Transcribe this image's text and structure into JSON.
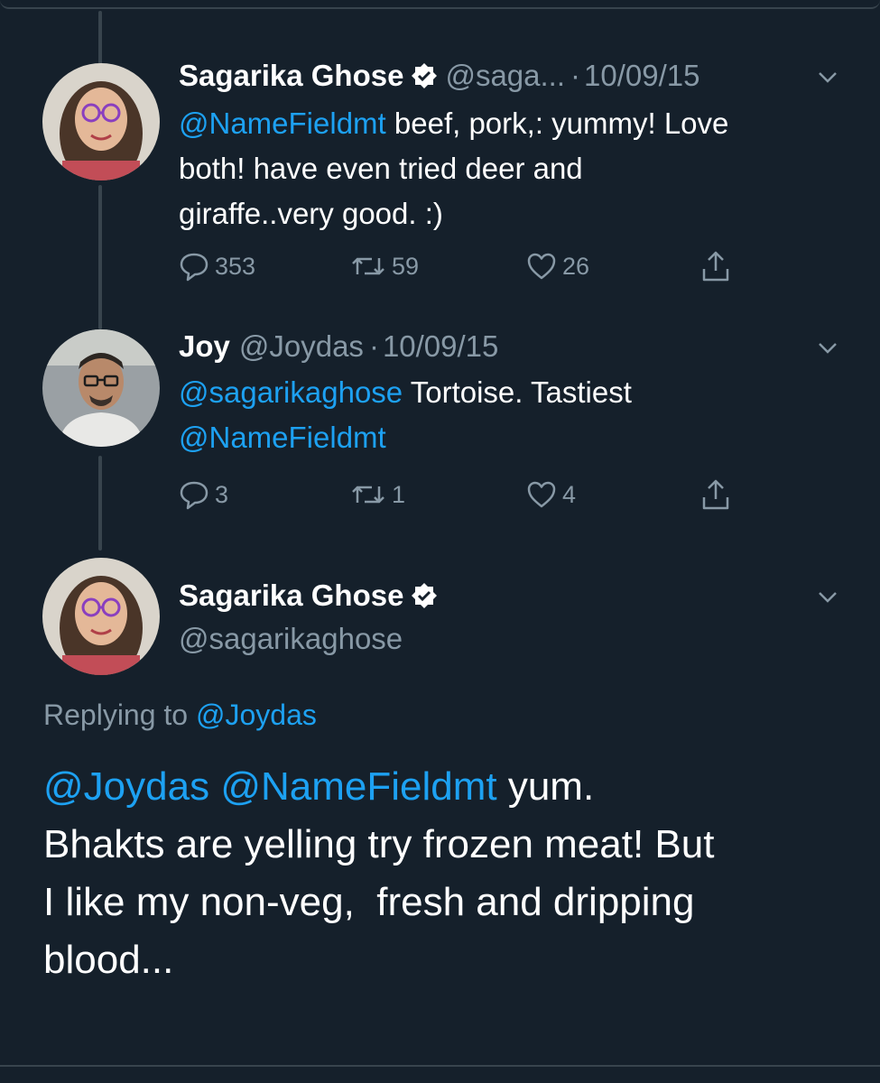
{
  "colors": {
    "background": "#15202b",
    "accent": "#1da1f2",
    "secondary_text": "#8899a6",
    "divider": "#38444d"
  },
  "tweets": [
    {
      "name": "Sagarika Ghose",
      "verified": true,
      "handle": "@saga...",
      "dot": "·",
      "date": "10/09/15",
      "mention": "@NameFieldmt",
      "text_line1": " beef, pork,: yummy! Love",
      "text_line2": "both! have even tried deer and",
      "text_line3": "giraffe..very good. :)",
      "replies": "353",
      "retweets": "59",
      "likes": "26"
    },
    {
      "name": "Joy",
      "verified": false,
      "handle": "@Joydas",
      "dot": "·",
      "date": "10/09/15",
      "mention1": "@sagarikaghose",
      "text": " Tortoise. Tastiest",
      "mention2": "@NameFieldmt",
      "replies": "3",
      "retweets": "1",
      "likes": "4"
    }
  ],
  "main_tweet": {
    "name": "Sagarika Ghose",
    "verified": true,
    "handle": "@sagarikaghose",
    "replying_prefix": "Replying to ",
    "replying_to": "@Joydas",
    "mention1": "@Joydas",
    "mention2": "@NameFieldmt",
    "line1_rest": " yum.",
    "line2": "Bhakts are yelling try frozen meat! But",
    "line3": "I like my non-veg,  fresh and dripping",
    "line4": "blood..."
  },
  "icons": [
    "reply-icon",
    "retweet-icon",
    "like-icon",
    "share-icon",
    "verified-badge-icon",
    "chevron-down-icon"
  ]
}
